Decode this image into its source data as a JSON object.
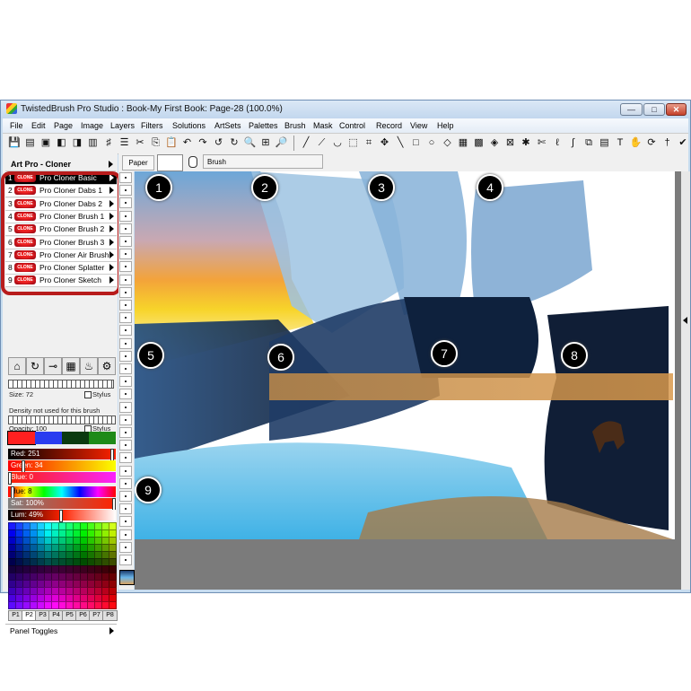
{
  "window": {
    "title": "TwistedBrush Pro Studio : Book-My First Book: Page-28 (100.0%)",
    "controls": {
      "minimize": "—",
      "maximize": "□",
      "close": "✕"
    }
  },
  "menu": [
    "File",
    "Edit",
    "Page",
    "Image",
    "Layers",
    "Filters",
    "Solutions",
    "ArtSets",
    "Palettes",
    "Brush",
    "Mask",
    "Control",
    "Record",
    "View",
    "Help"
  ],
  "toolbar": {
    "file_tools": [
      "save-icon",
      "save-all-icon",
      "page-icon",
      "page-prev-icon",
      "page-next-icon",
      "page-insert-icon",
      "magic-icon",
      "list-icon",
      "cut-icon",
      "copy-icon",
      "paste-icon",
      "undo-small-icon",
      "redo-small-icon",
      "undo-icon",
      "redo-icon",
      "zoom-in-icon",
      "fit-icon",
      "zoom-out-icon"
    ],
    "paint_tools": [
      "brush-tool-icon",
      "eyedropper-icon",
      "bucket-icon",
      "marquee-icon",
      "crop-icon",
      "move-icon",
      "line-icon",
      "rectangle-icon",
      "ellipse-icon",
      "fill-icon",
      "gradient-icon",
      "pattern-icon",
      "stamp-icon",
      "mask-icon",
      "magic-wand-icon",
      "scissors-icon",
      "lasso-icon",
      "smudge-icon",
      "clone-icon",
      "layer-icon",
      "text-icon",
      "hand-icon",
      "rotate-icon",
      "pin-icon",
      "check-brush-icon"
    ],
    "glyphs": {
      "file": [
        "💾",
        "▤",
        "▣",
        "◧",
        "◨",
        "▥",
        "♯",
        "☰",
        "✂",
        "⎘",
        "📋",
        "↶",
        "↷",
        "↺",
        "↻",
        "🔍",
        "⊞",
        "🔎"
      ],
      "paint": [
        "╱",
        "⟋",
        "◡",
        "⬚",
        "⌗",
        "✥",
        "╲",
        "□",
        "○",
        "◇",
        "▦",
        "▩",
        "◈",
        "⊠",
        "✱",
        "✄",
        "ℓ",
        "∫",
        "⧉",
        "▤",
        "T",
        "✋",
        "⟳",
        "†",
        "✔"
      ]
    }
  },
  "options_bar": {
    "paper_label": "Paper",
    "paper_color": "#ffffff",
    "brush_label": "Brush"
  },
  "panel": {
    "header": "Art Pro - Cloner",
    "presets": [
      {
        "num": "1",
        "badge": "CLONE",
        "label": "Pro Cloner Basic",
        "selected": true
      },
      {
        "num": "2",
        "badge": "CLONE",
        "label": "Pro Cloner Dabs 1"
      },
      {
        "num": "3",
        "badge": "CLONE",
        "label": "Pro Cloner Dabs 2"
      },
      {
        "num": "4",
        "badge": "CLONE",
        "label": "Pro Cloner Brush 1"
      },
      {
        "num": "5",
        "badge": "CLONE",
        "label": "Pro Cloner Brush 2"
      },
      {
        "num": "6",
        "badge": "CLONE",
        "label": "Pro Cloner Brush 3"
      },
      {
        "num": "7",
        "badge": "CLONE",
        "label": "Pro Cloner Air Brush"
      },
      {
        "num": "8",
        "badge": "CLONE",
        "label": "Pro Cloner Splatter"
      },
      {
        "num": "9",
        "badge": "CLONE",
        "label": "Pro Cloner Sketch"
      }
    ],
    "tool_icons": [
      "shape-icon",
      "reload-icon",
      "spray-icon",
      "texture-icon",
      "airbrush-icon",
      "settings-gear-icon"
    ],
    "tool_glyphs": [
      "⌂",
      "↻",
      "⊸",
      "▦",
      "♨",
      "⚙"
    ],
    "size": {
      "label": "Size: 72",
      "value": 72
    },
    "density": {
      "label": "Density not used for this brush"
    },
    "opacity": {
      "label": "Opacity: 100",
      "value": 100
    },
    "stylus_label": "Stylus",
    "swatches": [
      "#ff2020",
      "#2a3cf0",
      "#0b3a10",
      "#1e8a18"
    ],
    "rgb": {
      "red": {
        "label": "Red: 251",
        "value": 251
      },
      "green": {
        "label": "Green: 34",
        "value": 34
      },
      "blue": {
        "label": "Blue: 0",
        "value": 0
      }
    },
    "hsl": {
      "hue": {
        "label": "Hue: 8",
        "value": 8
      },
      "sat": {
        "label": "Sat: 100%",
        "value": 100
      },
      "lum": {
        "label": "Lum: 49%",
        "value": 49
      }
    },
    "palette_tabs": [
      "P1",
      "P2",
      "P3",
      "P4",
      "P5",
      "P6",
      "P7",
      "P8"
    ],
    "palette_selected": "P2",
    "panel_toggles": "Panel Toggles"
  },
  "canvas": {
    "markers": [
      "1",
      "2",
      "3",
      "4",
      "5",
      "6",
      "7",
      "8",
      "9"
    ]
  }
}
